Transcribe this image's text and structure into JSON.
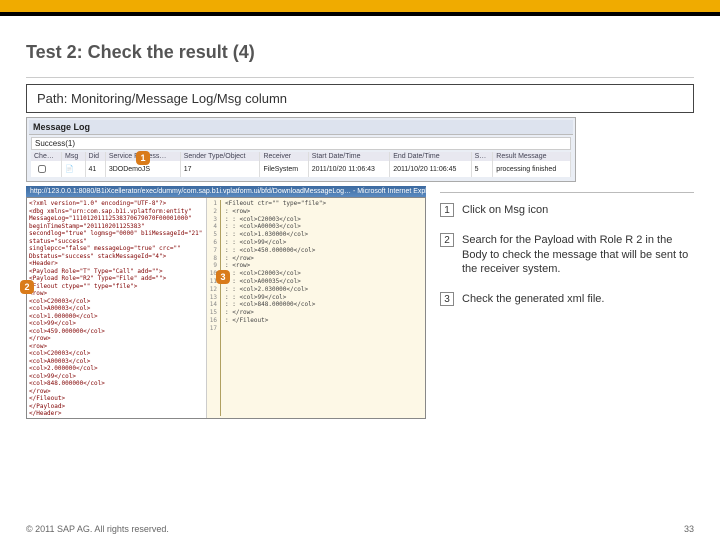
{
  "title": "Test 2: Check the result (4)",
  "path_label": "Path:  Monitoring/Message Log/Msg column",
  "msglog": {
    "header": "Message Log",
    "success": "Success(1)",
    "cols": {
      "c1": "Che…",
      "c2": "Msg",
      "c3": "Did",
      "c4": "Service Process…",
      "c5": "Sender Type/Object",
      "c6": "Receiver",
      "c7": "Start Date/Time",
      "c8": "End Date/Time",
      "c9": "S…",
      "c10": "Result Message"
    },
    "row": {
      "v3": "41",
      "v4": "3DODemoJS",
      "v5": "17",
      "v6": "FileSystem",
      "v7": "2011/10/20 11:06:43",
      "v8": "2011/10/20 11:06:45",
      "v9": "5",
      "v10": "processing finished"
    }
  },
  "ie_url": "http://123.0.0.1:8080/B1iXcellerator/exec/dummy/com.sap.b1i.vplatform.ui/bfd/DownloadMessageLog… - Microsoft Internet Explorer",
  "xml_left": [
    "<?xml version=\"1.0\" encoding=\"UTF-8\"?>",
    "<dbg xmlns=\"urn:com.sap.b1i.vplatform:entity\" MessageLog=\"11101201112538370679070F00001000\"",
    "  beginTimeStamp=\"201110201125383\" secondlog=\"true\" logmsg=\"0000\" b1iMessageId=\"21\" status=\"success\"",
    "  singlepcc=\"false\" messageLog=\"true\" crc=\"\" Dbstatus=\"success\" stackMessageId=\"4\">",
    "<Header>",
    " <Payload Role=\"T\" Type=\"Call\" add=\"\">",
    " <Payload Role=\"R2\" Type=\"File\" add=\"\">",
    "  <Fileout ctype=\"\" type=\"file\">",
    "   <row>",
    "    <col>C20003</col>",
    "    <col>A00003</col>",
    "    <col>1.000000</col>",
    "    <col>99</col>",
    "    <col>459.000000</col>",
    "   </row>",
    "   <row>",
    "    <col>C20003</col>",
    "    <col>A00003</col>",
    "    <col>2.000000</col>",
    "    <col>99</col>",
    "    <col>848.000000</col>",
    "   </row>",
    "  </Fileout>",
    " </Payload>",
    "</Header>"
  ],
  "xml_right_lines": [
    " <Fileout ctr=\"\" type=\"file\">",
    "  : <row>",
    "  : : <col>C20003</col>",
    "  : : <col>A00003</col>",
    "  : : <col>1.030000</col>",
    "  : : <col>99</col>",
    "  : : <col>450.000000</col>",
    "  : </row>",
    "  : <row>",
    "  : : <col>C20003</col>",
    "  : : <col>A00035</col>",
    "  : : <col>2.030000</col>",
    "  : : <col>99</col>",
    "  : : <col>848.000000</col>",
    "  : </row>",
    "  : </Fileout>",
    ""
  ],
  "steps": [
    {
      "n": "1",
      "text": "Click on Msg icon"
    },
    {
      "n": "2",
      "text": "Search for the Payload with Role R 2 in the Body to check the message that will be sent to the receiver system."
    },
    {
      "n": "3",
      "text": "Check the generated xml file."
    }
  ],
  "markers": {
    "m1": "1",
    "m2": "2",
    "m3": "3"
  },
  "footer": {
    "left": "© 2011 SAP AG. All rights reserved.",
    "right": "33"
  }
}
